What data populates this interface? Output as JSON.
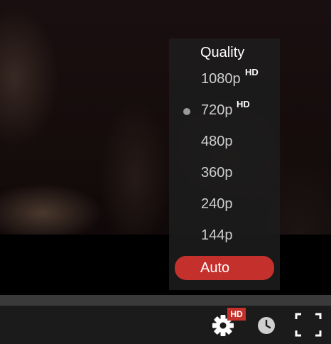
{
  "quality_menu": {
    "title": "Quality",
    "options": [
      {
        "label": "1080p",
        "hd": "HD"
      },
      {
        "label": "720p",
        "hd": "HD",
        "selected_indicator": true
      },
      {
        "label": "480p"
      },
      {
        "label": "360p"
      },
      {
        "label": "240p"
      },
      {
        "label": "144p"
      }
    ],
    "auto": {
      "label": "Auto",
      "highlighted": true
    }
  },
  "controls": {
    "settings_badge": "HD",
    "icons": [
      "gear-icon",
      "clock-icon",
      "fullscreen-icon"
    ]
  },
  "colors": {
    "accent": "#c4302b",
    "menu_bg": "#1c1c1c",
    "progress_bar": "#3a3a3a",
    "control_bar": "#1b1b1b"
  }
}
